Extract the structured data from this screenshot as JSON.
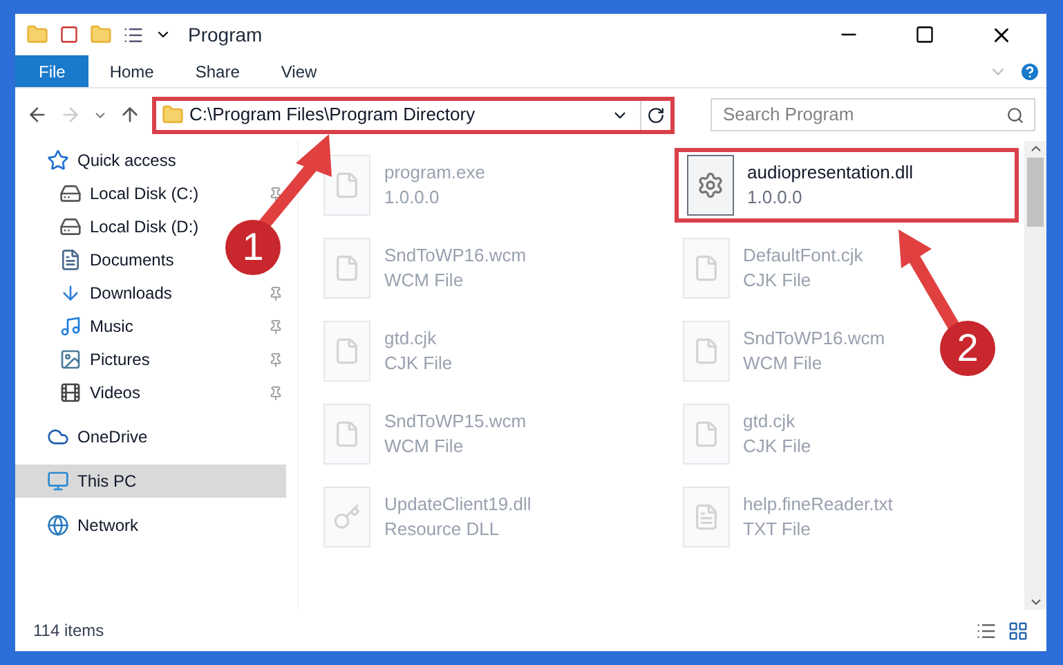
{
  "window": {
    "title": "Program"
  },
  "ribbon_tabs": [
    {
      "label": "File",
      "selected": true
    },
    {
      "label": "Home",
      "selected": false
    },
    {
      "label": "Share",
      "selected": false
    },
    {
      "label": "View",
      "selected": false
    }
  ],
  "address_bar": {
    "path": "C:\\Program Files\\Program Directory",
    "highlighted": true
  },
  "search": {
    "placeholder": "Search Program"
  },
  "sidebar": {
    "items": [
      {
        "label": "Quick access",
        "kind": "section",
        "pinned": false,
        "selected": false
      },
      {
        "label": "Local Disk (C:)",
        "kind": "place",
        "pinned": true,
        "selected": false
      },
      {
        "label": "Local Disk (D:)",
        "kind": "place",
        "pinned": false,
        "selected": false
      },
      {
        "label": "Documents",
        "kind": "place",
        "pinned": false,
        "selected": false
      },
      {
        "label": "Downloads",
        "kind": "place",
        "pinned": true,
        "selected": false
      },
      {
        "label": "Music",
        "kind": "place",
        "pinned": true,
        "selected": false
      },
      {
        "label": "Pictures",
        "kind": "place",
        "pinned": true,
        "selected": false
      },
      {
        "label": "Videos",
        "kind": "place",
        "pinned": true,
        "selected": false
      },
      {
        "label": "OneDrive",
        "kind": "section",
        "pinned": false,
        "selected": false
      },
      {
        "label": "This PC",
        "kind": "section",
        "pinned": false,
        "selected": true
      },
      {
        "label": "Network",
        "kind": "section",
        "pinned": false,
        "selected": false
      }
    ]
  },
  "files": [
    {
      "name": "program.exe",
      "detail": "1.0.0.0",
      "kind": "exe",
      "faded": true,
      "highlighted": false
    },
    {
      "name": "audiopresentation.dll",
      "detail": "1.0.0.0",
      "kind": "dll",
      "faded": false,
      "highlighted": true
    },
    {
      "name": "SndToWP16.wcm",
      "detail": "WCM File",
      "kind": "blank",
      "faded": true,
      "highlighted": false
    },
    {
      "name": "DefaultFont.cjk",
      "detail": "CJK File",
      "kind": "blank",
      "faded": true,
      "highlighted": false
    },
    {
      "name": "gtd.cjk",
      "detail": "CJK File",
      "kind": "blank",
      "faded": true,
      "highlighted": false
    },
    {
      "name": "SndToWP16.wcm",
      "detail": "WCM File",
      "kind": "blank",
      "faded": true,
      "highlighted": false
    },
    {
      "name": "SndToWP15.wcm",
      "detail": "WCM File",
      "kind": "blank",
      "faded": true,
      "highlighted": false
    },
    {
      "name": "gtd.cjk",
      "detail": "CJK File",
      "kind": "blank",
      "faded": true,
      "highlighted": false
    },
    {
      "name": "UpdateClient19.dll",
      "detail": "Resource DLL",
      "kind": "key",
      "faded": true,
      "highlighted": false
    },
    {
      "name": "help.fineReader.txt",
      "detail": "TXT File",
      "kind": "text",
      "faded": true,
      "highlighted": false
    }
  ],
  "status_bar": {
    "item_count": "114 items"
  },
  "annotations": [
    {
      "number": "1"
    },
    {
      "number": "2"
    }
  ]
}
